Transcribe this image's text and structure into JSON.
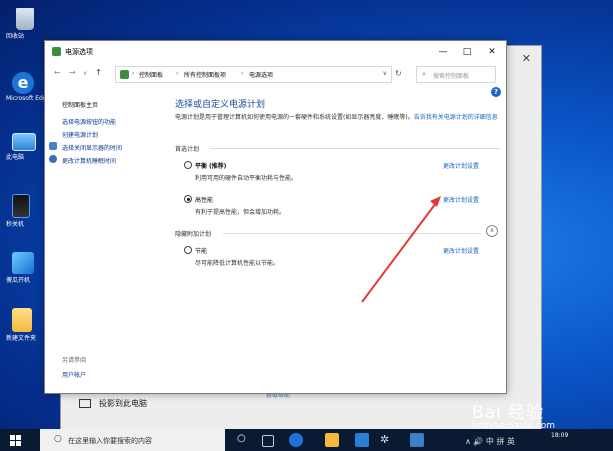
{
  "desktop": {
    "icons": [
      {
        "label": "回收站",
        "icon": "recycle-bin-icon"
      },
      {
        "label": "Microsoft Edge",
        "icon": "edge-icon"
      },
      {
        "label": "此电脑",
        "icon": "pc-icon"
      },
      {
        "label": "秒关机",
        "icon": "app-icon"
      },
      {
        "label": "傻瓜开机",
        "icon": "app-icon"
      },
      {
        "label": "新建文件夹",
        "icon": "folder-icon"
      }
    ]
  },
  "bg_window": {
    "item_label": "投影到此电脑",
    "link_text": "获取帮助"
  },
  "window": {
    "title": "电源选项",
    "minimize_glyph": "—",
    "maximize_glyph": "□",
    "close_glyph": "✕",
    "breadcrumbs": [
      "控制面板",
      "所有控制面板项",
      "电源选项"
    ],
    "search_placeholder": "搜索控制面板",
    "sidebar": {
      "home": "控制面板主页",
      "items": [
        "选择电源按钮的功能",
        "创建电源计划",
        "选择关闭显示器的时间",
        "更改计算机睡眠时间"
      ],
      "see_also": "另请参阅",
      "user_accounts": "用户帐户"
    },
    "main": {
      "heading": "选择或自定义电源计划",
      "description": "电源计划是用于管理计算机如何使用电源的一套硬件和系统设置(如显示器亮度、睡眠等)。",
      "description_link": "告诉我有关电源计划的详细信息",
      "preferred_group": "首选计划",
      "hidden_group": "隐藏附加计划",
      "change_link": "更改计划设置",
      "plans": [
        {
          "name": "平衡",
          "tag": "(推荐)",
          "desc": "利用可用的硬件自动平衡功耗与性能。",
          "selected": false
        },
        {
          "name": "高性能",
          "tag": "",
          "desc": "有利于提高性能，但会增加功耗。",
          "selected": true
        },
        {
          "name": "节能",
          "tag": "",
          "desc": "尽可能降低计算机性能以节能。",
          "selected": false
        }
      ]
    }
  },
  "taskbar": {
    "search_placeholder": "在这里输入你要搜索的内容",
    "tray_text": "∧ 🔊 中 拼 英",
    "time": "18:09"
  },
  "watermark": {
    "brand": "Bai 经验",
    "url": "jingyan.baidu.com"
  },
  "colors": {
    "accent": "#1565c0",
    "arrow": "#e53935"
  }
}
